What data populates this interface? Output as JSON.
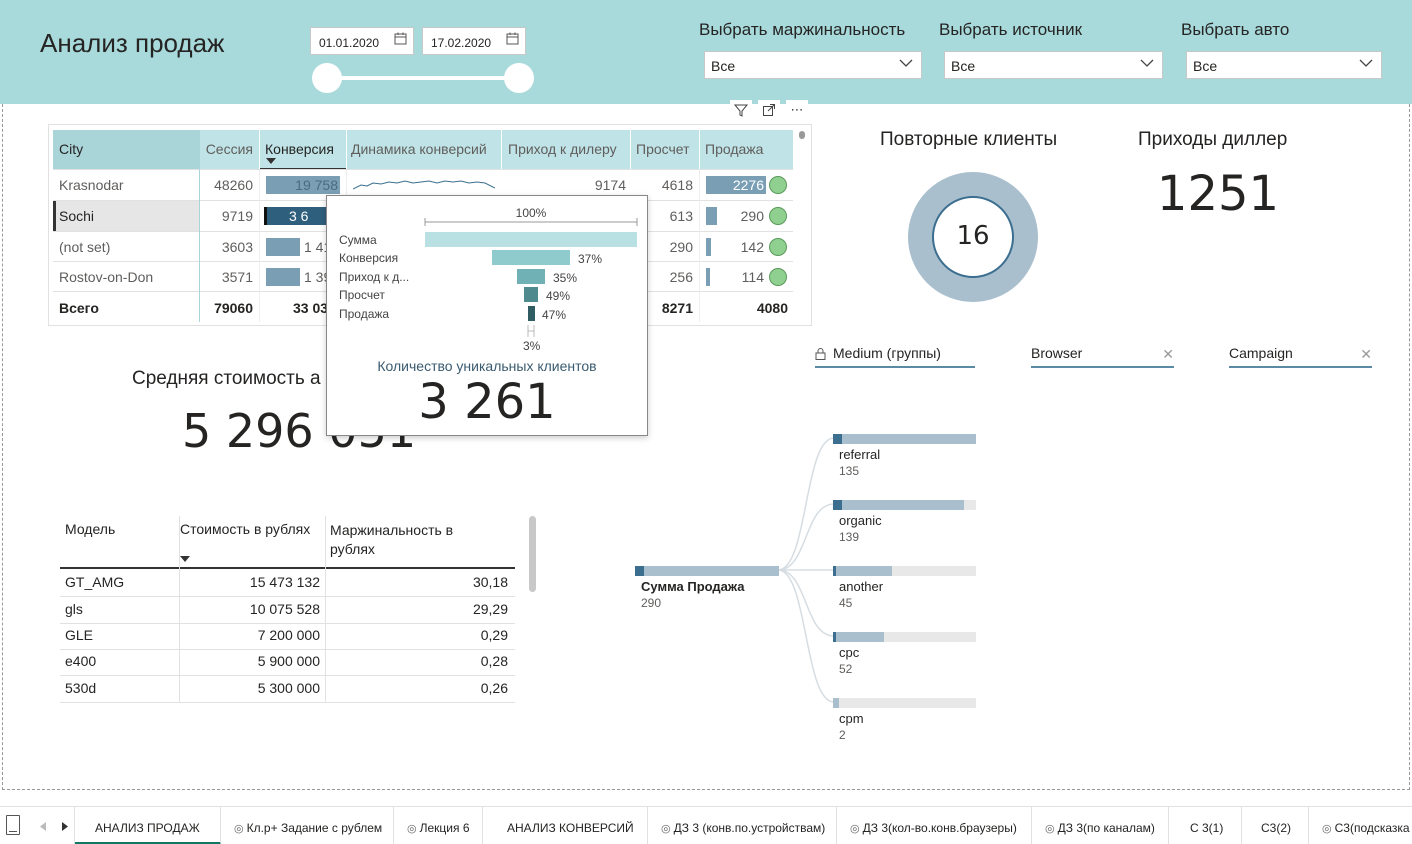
{
  "header": {
    "title": "Анализ продаж",
    "date_from": "01.01.2020",
    "date_to": "17.02.2020",
    "filters": [
      {
        "label": "Выбрать маржинальность",
        "value": "Все"
      },
      {
        "label": "Выбрать источник",
        "value": "Все"
      },
      {
        "label": "Выбрать авто",
        "value": "Все"
      }
    ]
  },
  "city_table": {
    "columns": [
      "City",
      "Сессия",
      "Конверсия",
      "Динамика конверсий",
      "Приход к дилеру",
      "Просчет",
      "Продажа"
    ],
    "rows": [
      {
        "city": "Krasnodar",
        "session": "48260",
        "conversion": "19 758",
        "dealer": "9174",
        "calc": "4618",
        "sale": "2276"
      },
      {
        "city": "Sochi",
        "session": "9719",
        "conversion": "3 6",
        "dealer": "",
        "calc": "613",
        "sale": "290"
      },
      {
        "city": "(not set)",
        "session": "3603",
        "conversion": "1 41",
        "dealer": "",
        "calc": "290",
        "sale": "142"
      },
      {
        "city": "Rostov-on-Don",
        "session": "3571",
        "conversion": "1 39",
        "dealer": "",
        "calc": "256",
        "sale": "114"
      }
    ],
    "total": {
      "label": "Всего",
      "session": "79060",
      "conversion": "33 03",
      "calc": "8271",
      "sale": "4080"
    }
  },
  "tooltip": {
    "top_pct": "100%",
    "stages": [
      {
        "label": "Сумма",
        "pct": "",
        "fraction": 1.0
      },
      {
        "label": "Конверсия",
        "pct": "37%",
        "fraction": 0.37
      },
      {
        "label": "Приход к д...",
        "pct": "35%",
        "fraction": 0.13
      },
      {
        "label": "Просчет",
        "pct": "49%",
        "fraction": 0.064
      },
      {
        "label": "Продажа",
        "pct": "47%",
        "fraction": 0.03
      }
    ],
    "bottom_pct": "3%",
    "metric_label": "Количество уникальных клиентов",
    "metric_value": "3 261"
  },
  "kpis": {
    "repeat_clients_title": "Повторные клиенты",
    "repeat_clients_value": "16",
    "dealer_visits_title": "Приходы диллер",
    "dealer_visits_value": "1251",
    "avg_cost_title": "Средняя стоимость а",
    "avg_cost_value": "5 296 051"
  },
  "model_table": {
    "columns": [
      "Модель",
      "Стоимость в рублях",
      "Маржинальность в рублях"
    ],
    "rows": [
      {
        "model": "GT_AMG",
        "cost": "15 473 132",
        "margin": "30,18"
      },
      {
        "model": "gls",
        "cost": "10 075 528",
        "margin": "29,29"
      },
      {
        "model": "GLE",
        "cost": "7 200 000",
        "margin": "0,29"
      },
      {
        "model": "e400",
        "cost": "5 900 000",
        "margin": "0,28"
      },
      {
        "model": "530d",
        "cost": "5 300 000",
        "margin": "0,26"
      }
    ]
  },
  "decomposition": {
    "headers": [
      "Medium (группы)",
      "Browser",
      "Campaign"
    ],
    "root": {
      "label": "Сумма Продажа",
      "value": "290"
    },
    "nodes": [
      {
        "label": "referral",
        "value": "135",
        "fraction": 1.0
      },
      {
        "label": "organic",
        "value": "139",
        "fraction": 0.9
      },
      {
        "label": "another",
        "value": "45",
        "fraction": 0.4
      },
      {
        "label": "cpc",
        "value": "52",
        "fraction": 0.35
      },
      {
        "label": "cpm",
        "value": "2",
        "fraction": 0.04
      }
    ]
  },
  "tabs": [
    {
      "label": "АНАЛИЗ ПРОДАЖ",
      "hidden": false
    },
    {
      "label": "Кл.р+ Задание с рублем",
      "hidden": true
    },
    {
      "label": "Лекция 6",
      "hidden": true
    },
    {
      "label": "АНАЛИЗ КОНВЕРСИЙ",
      "hidden": false
    },
    {
      "label": "ДЗ 3 (конв.по.устройствам)",
      "hidden": true
    },
    {
      "label": "ДЗ 3(кол-во.конв.браузеры)",
      "hidden": true
    },
    {
      "label": "ДЗ 3(по каналам)",
      "hidden": true
    },
    {
      "label": "С 3(1)",
      "hidden": false
    },
    {
      "label": "С3(2)",
      "hidden": false
    },
    {
      "label": "С3(подсказка",
      "hidden": true
    }
  ],
  "colors": {
    "header_bg": "#a8dadc",
    "bar_dark": "#2e5f7d",
    "bar_mid": "#7a9fb5",
    "funnel_light": "#b9e0e2",
    "funnel_dark": "#2f5d62",
    "status_green": "#8fcf8f"
  }
}
